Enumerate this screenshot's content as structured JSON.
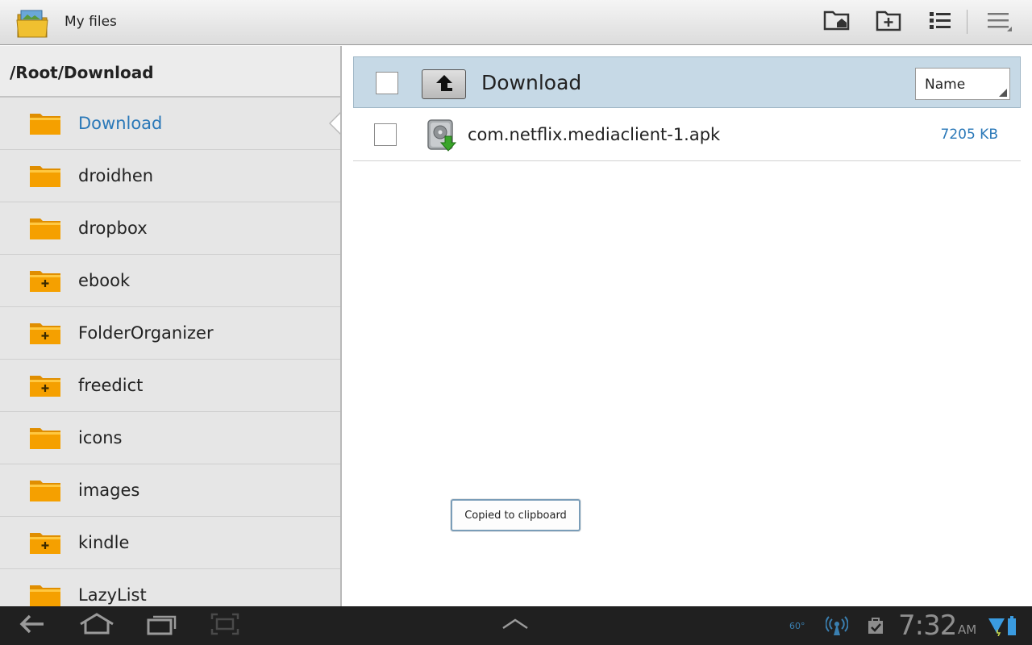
{
  "app": {
    "title": "My files",
    "icon": "folder-app-icon"
  },
  "toolbar": {
    "buttons": [
      {
        "name": "home-folder-button",
        "icon": "folder-home-icon"
      },
      {
        "name": "new-folder-button",
        "icon": "folder-plus-icon"
      },
      {
        "name": "list-view-button",
        "icon": "list-view-icon"
      },
      {
        "name": "overflow-menu-button",
        "icon": "menu-icon"
      }
    ]
  },
  "sidebar": {
    "path": "/Root/Download",
    "items": [
      {
        "label": "Download",
        "selected": true,
        "has_subfolders": false
      },
      {
        "label": "droidhen",
        "selected": false,
        "has_subfolders": false
      },
      {
        "label": "dropbox",
        "selected": false,
        "has_subfolders": false
      },
      {
        "label": "ebook",
        "selected": false,
        "has_subfolders": true
      },
      {
        "label": "FolderOrganizer",
        "selected": false,
        "has_subfolders": true
      },
      {
        "label": "freedict",
        "selected": false,
        "has_subfolders": true
      },
      {
        "label": "icons",
        "selected": false,
        "has_subfolders": false
      },
      {
        "label": "images",
        "selected": false,
        "has_subfolders": false
      },
      {
        "label": "kindle",
        "selected": false,
        "has_subfolders": true
      },
      {
        "label": "LazyList",
        "selected": false,
        "has_subfolders": false
      }
    ]
  },
  "main": {
    "directory": "Download",
    "sort": {
      "selected": "Name"
    },
    "files": [
      {
        "name": "com.netflix.mediaclient-1.apk",
        "size": "7205 KB",
        "icon": "apk-install-icon"
      }
    ],
    "toast": "Copied to clipboard"
  },
  "systembar": {
    "temperature": "60°",
    "time": "7:32",
    "ampm": "AM"
  },
  "colors": {
    "accent": "#2a78b8",
    "header_bg": "#c6d9e6",
    "folder": "#f5a000"
  }
}
